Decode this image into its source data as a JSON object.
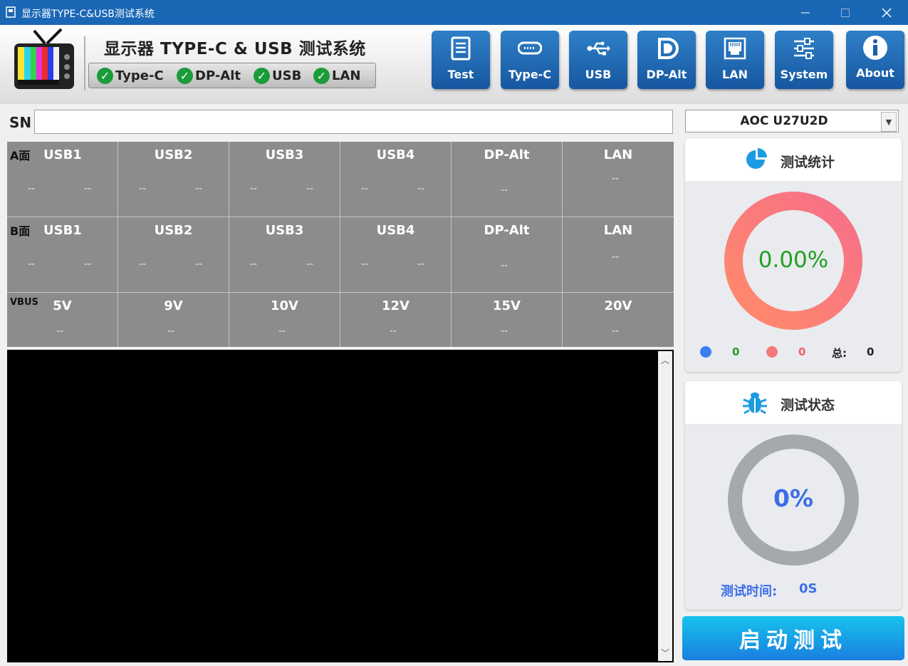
{
  "window": {
    "title": "显示器TYPE-C&USB测试系统"
  },
  "header": {
    "title": "显示器 TYPE-C & USB 测试系统",
    "status": [
      {
        "label": "Type-C",
        "ok": true
      },
      {
        "label": "DP-Alt",
        "ok": true
      },
      {
        "label": "USB",
        "ok": true
      },
      {
        "label": "LAN",
        "ok": true
      }
    ],
    "nav": [
      {
        "label": "Test",
        "icon": "document-list-icon"
      },
      {
        "label": "Type-C",
        "icon": "usb-c-port-icon"
      },
      {
        "label": "USB",
        "icon": "usb-icon"
      },
      {
        "label": "DP-Alt",
        "icon": "displayport-icon"
      },
      {
        "label": "LAN",
        "icon": "ethernet-port-icon"
      },
      {
        "label": "System",
        "icon": "sliders-icon"
      },
      {
        "label": "About",
        "icon": "info-icon"
      }
    ]
  },
  "sn": {
    "label": "SN",
    "value": ""
  },
  "grid": {
    "side_a": {
      "label": "A面",
      "cells": [
        {
          "header": "USB1",
          "v1": "--",
          "v2": "--"
        },
        {
          "header": "USB2",
          "v1": "--",
          "v2": "--"
        },
        {
          "header": "USB3",
          "v1": "--",
          "v2": "--"
        },
        {
          "header": "USB4",
          "v1": "--",
          "v2": "--"
        },
        {
          "header": "DP-Alt",
          "v1": "--"
        },
        {
          "header": "LAN",
          "v1": "--"
        }
      ]
    },
    "side_b": {
      "label": "B面",
      "cells": [
        {
          "header": "USB1",
          "v1": "--",
          "v2": "--"
        },
        {
          "header": "USB2",
          "v1": "--",
          "v2": "--"
        },
        {
          "header": "USB3",
          "v1": "--",
          "v2": "--"
        },
        {
          "header": "USB4",
          "v1": "--",
          "v2": "--"
        },
        {
          "header": "DP-Alt",
          "v1": "--"
        },
        {
          "header": "LAN",
          "v1": "--"
        }
      ]
    },
    "vbus": {
      "label": "VBUS",
      "cells": [
        {
          "header": "5V",
          "v1": "--"
        },
        {
          "header": "9V",
          "v1": "--"
        },
        {
          "header": "10V",
          "v1": "--"
        },
        {
          "header": "12V",
          "v1": "--"
        },
        {
          "header": "15V",
          "v1": "--"
        },
        {
          "header": "20V",
          "v1": "--"
        }
      ]
    }
  },
  "model": {
    "selected": "AOC U27U2D"
  },
  "stats": {
    "title": "测试统计",
    "percent": "0.00%",
    "pass": "0",
    "fail": "0",
    "total_label": "总:",
    "total": "0"
  },
  "status": {
    "title": "测试状态",
    "percent": "0%",
    "time_label": "测试时间:",
    "time": "0S"
  },
  "start_button": {
    "label": "启动测试"
  },
  "colors": {
    "titlebar": "#1a67b5",
    "nav_button": "#1f6db8",
    "pass_dot": "#3a7ff0",
    "fail_dot": "#f47a7a",
    "check": "#1a9c3a",
    "start_button": "#19a6ea"
  }
}
